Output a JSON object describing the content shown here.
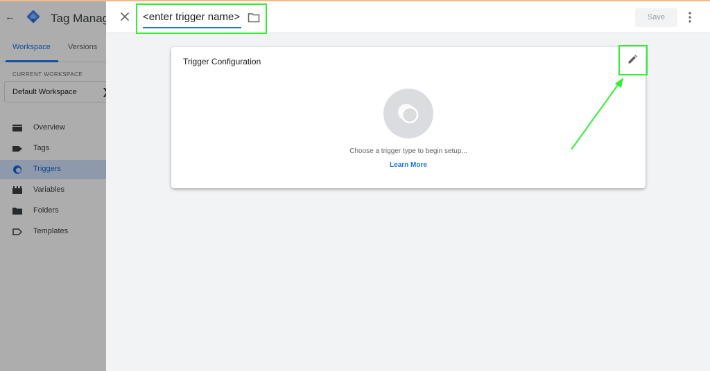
{
  "app": {
    "title": "Tag Manager"
  },
  "sidebar": {
    "tabs": [
      {
        "label": "Workspace",
        "active": true
      },
      {
        "label": "Versions",
        "active": false
      }
    ],
    "current_workspace_label": "CURRENT WORKSPACE",
    "current_workspace_name": "Default Workspace",
    "nav": [
      {
        "label": "Overview",
        "icon": "overview-icon",
        "active": false
      },
      {
        "label": "Tags",
        "icon": "tag-icon",
        "active": false
      },
      {
        "label": "Triggers",
        "icon": "trigger-icon",
        "active": true
      },
      {
        "label": "Variables",
        "icon": "variables-icon",
        "active": false
      },
      {
        "label": "Folders",
        "icon": "folder-icon",
        "active": false
      },
      {
        "label": "Templates",
        "icon": "template-icon",
        "active": false
      }
    ]
  },
  "editor": {
    "trigger_name_value": "<enter trigger name>",
    "save_label": "Save"
  },
  "card": {
    "title": "Trigger Configuration",
    "empty_text": "Choose a trigger type to begin setup...",
    "learn_more": "Learn More"
  },
  "colors": {
    "accent": "#1a73e8",
    "highlight": "#33ee33",
    "active_nav_bg": "#d2e3fc"
  }
}
